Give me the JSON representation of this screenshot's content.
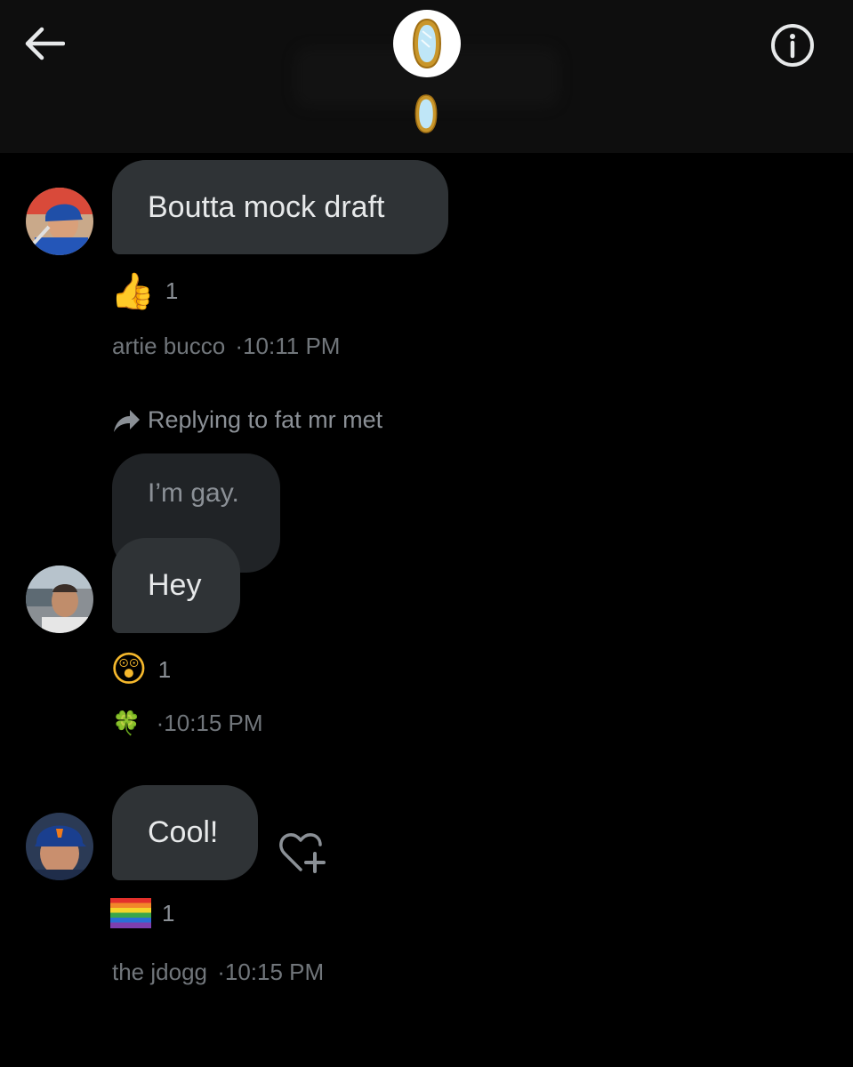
{
  "colors": {
    "background": "#000000",
    "header_bg": "#0e0e0e",
    "bubble": "#2f3336",
    "quoted_bubble": "#202326",
    "text": "#e7e9ea",
    "muted": "#71767b"
  },
  "header": {
    "back_icon": "arrow-left-icon",
    "info_icon": "info-icon",
    "group_avatar_icon": "mirror-icon",
    "group_name_icon": "mirror-icon"
  },
  "messages": [
    {
      "text": "Boutta mock draft",
      "avatar": "avatar-baseball-player-blue-helmet",
      "reaction": {
        "emoji": "👍",
        "count": "1"
      },
      "sender": "artie bucco",
      "time": "·10:11 PM"
    },
    {
      "reply_label": "Replying to fat mr met",
      "quoted_text": "I’m gay.",
      "text": "Hey",
      "avatar": "avatar-man-stadium",
      "reaction": {
        "emoji": "😲",
        "count": "1"
      },
      "sender_emoji": "🍀",
      "time": "·10:15 PM"
    },
    {
      "text": "Cool!",
      "avatar": "avatar-mets-cap",
      "reaction": {
        "emoji": "🏳️‍🌈",
        "count": "1"
      },
      "sender": "the jdogg",
      "time": "·10:15 PM",
      "add_reaction_icon": "heart-plus-icon"
    }
  ]
}
